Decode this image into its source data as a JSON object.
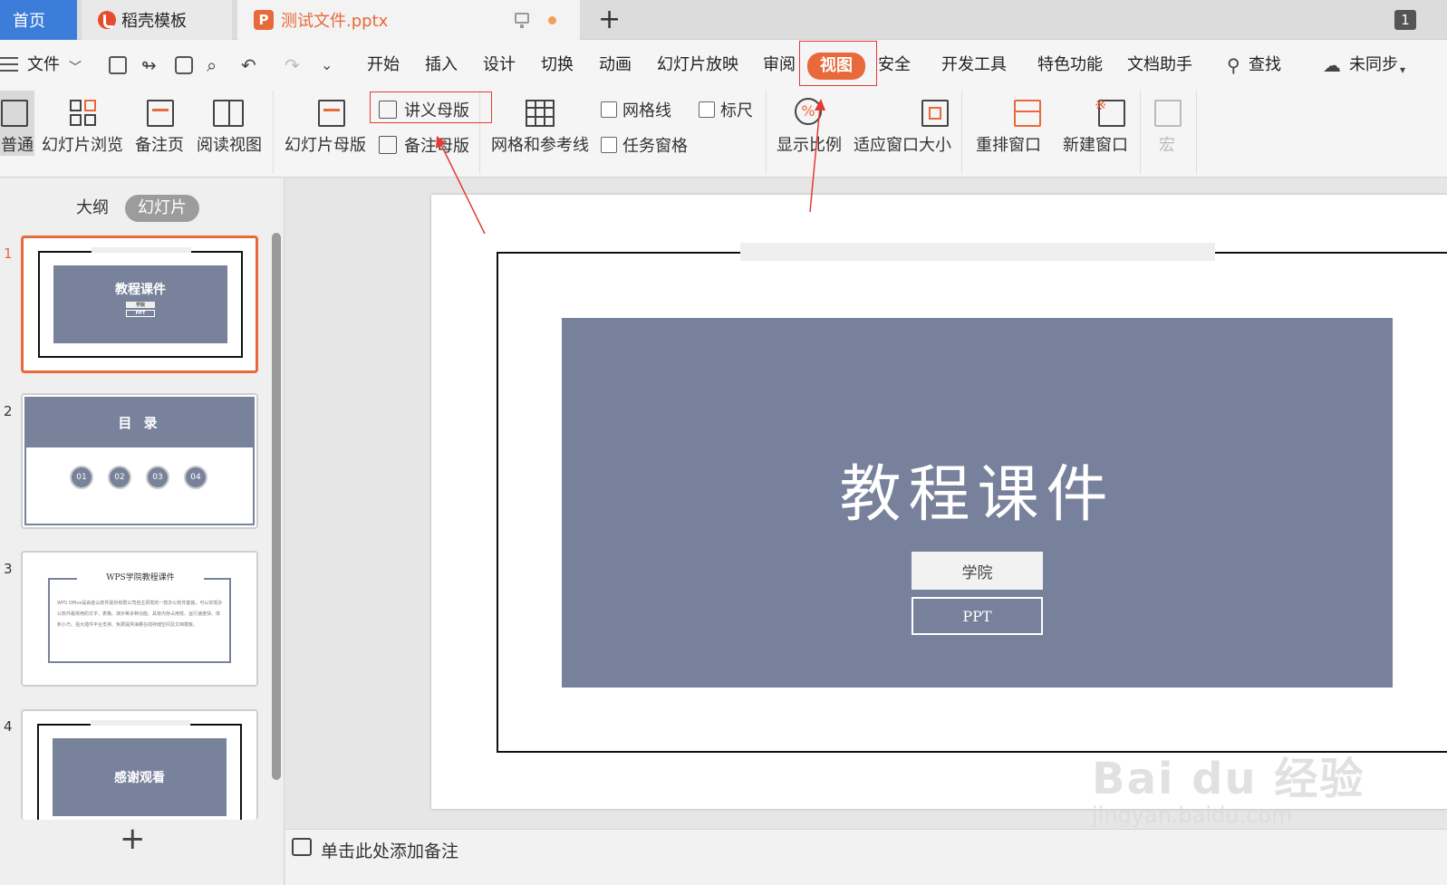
{
  "tabs": {
    "home": "首页",
    "docer": "稻壳模板",
    "file": "测试文件.pptx",
    "new_tab": "+",
    "window_count": "1"
  },
  "menu": {
    "file": "文件",
    "items": [
      "开始",
      "插入",
      "设计",
      "切换",
      "动画",
      "幻灯片放映",
      "审阅",
      "视图",
      "安全",
      "开发工具",
      "特色功能",
      "文档助手"
    ],
    "search": "查找",
    "sync": "未同步"
  },
  "ribbon": {
    "normal": "普通",
    "slide_browse": "幻灯片浏览",
    "notes_page": "备注页",
    "reading_view": "阅读视图",
    "slide_master": "幻灯片母版",
    "handout_master": "讲义母版",
    "notes_master": "备注母版",
    "grid_guides": "网格和参考线",
    "gridlines": "网格线",
    "ruler": "标尺",
    "task_pane": "任务窗格",
    "zoom": "显示比例",
    "fit_window": "适应窗口大小",
    "rearrange": "重排窗口",
    "new_window": "新建窗口",
    "macro": "宏"
  },
  "sidebar": {
    "outline_tab": "大纲",
    "slides_tab": "幻灯片",
    "thumbs": [
      {
        "num": "1",
        "title": "教程课件",
        "sub1": "学院",
        "sub2": "PPT"
      },
      {
        "num": "2",
        "title": "目 录",
        "items": [
          "01",
          "02",
          "03",
          "04"
        ]
      },
      {
        "num": "3",
        "title": "WPS学院教程课件",
        "body": "WPS Office是由金山软件股份有限公司自主研发的一款办公软件套装，可以实现办公软件最常用的文字、表格、演示等多种功能。具有内存占用低、运行速度快、体积小巧、强大插件平台支持、免费提供海量在线存储空间及文档模板。"
      },
      {
        "num": "4",
        "title": "感谢观看"
      }
    ],
    "add": "+"
  },
  "slide": {
    "title": "教程课件",
    "button1": "学院",
    "button2": "PPT"
  },
  "notes": {
    "placeholder": "单击此处添加备注"
  },
  "watermark": {
    "brand": "Bai du 经验",
    "url": "jingyan.baidu.com"
  },
  "colors": {
    "accent": "#e8693a",
    "home_tab": "#3b7dd8",
    "slide_block": "#78819b",
    "annotation": "#e53935"
  }
}
